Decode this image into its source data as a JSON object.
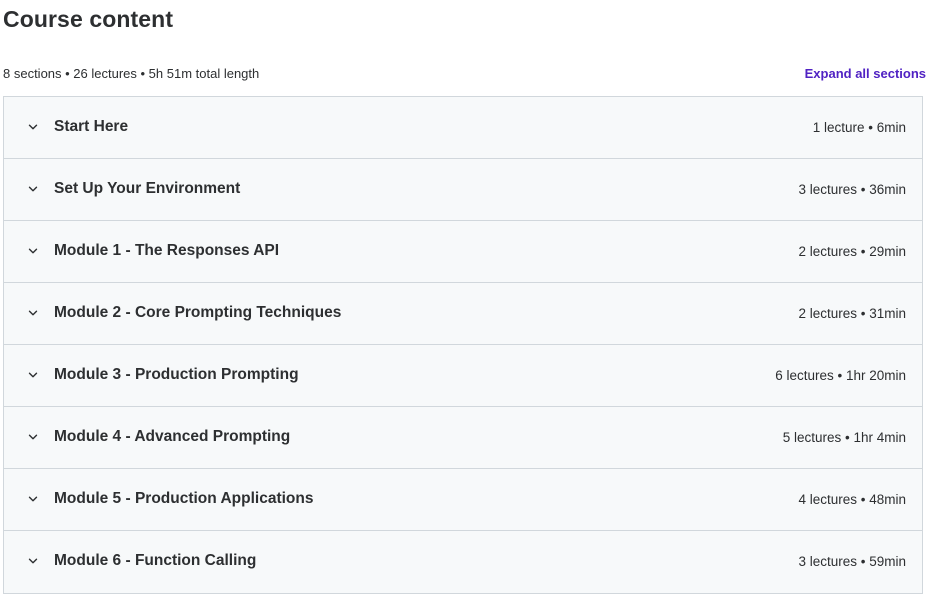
{
  "header": {
    "title": "Course content",
    "summary": "8 sections • 26 lectures • 5h 51m total length",
    "expand_label": "Expand all sections"
  },
  "colors": {
    "accent": "#5022c3",
    "section_bg": "#f7f9fa",
    "border": "#d1d7dc",
    "text": "#2d2f31"
  },
  "sections": [
    {
      "title": "Start Here",
      "meta": "1 lecture • 6min",
      "icon": "chevron-down-icon"
    },
    {
      "title": "Set Up Your Environment",
      "meta": "3 lectures • 36min",
      "icon": "chevron-down-icon"
    },
    {
      "title": "Module 1 - The Responses API",
      "meta": "2 lectures • 29min",
      "icon": "chevron-down-icon"
    },
    {
      "title": "Module 2 - Core Prompting Techniques",
      "meta": "2 lectures • 31min",
      "icon": "chevron-down-icon"
    },
    {
      "title": "Module 3 - Production Prompting",
      "meta": "6 lectures • 1hr 20min",
      "icon": "chevron-down-icon"
    },
    {
      "title": "Module 4 - Advanced Prompting",
      "meta": "5 lectures • 1hr 4min",
      "icon": "chevron-down-icon"
    },
    {
      "title": "Module 5 - Production Applications",
      "meta": "4 lectures • 48min",
      "icon": "chevron-down-icon"
    },
    {
      "title": "Module 6 - Function Calling",
      "meta": "3 lectures • 59min",
      "icon": "chevron-down-icon"
    }
  ]
}
